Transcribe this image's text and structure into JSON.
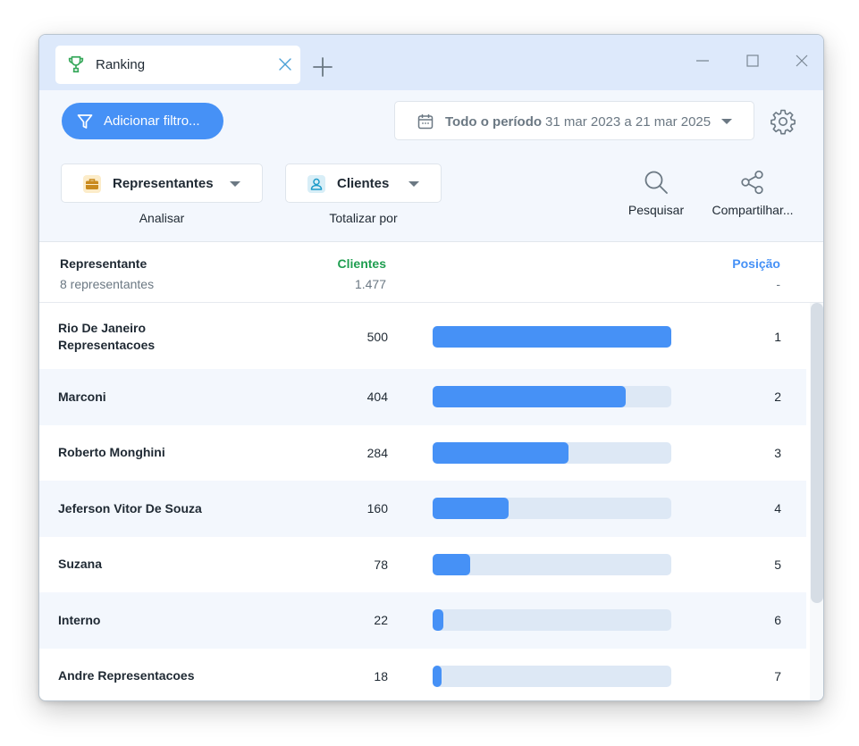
{
  "tab": {
    "title": "Ranking"
  },
  "toolbar": {
    "add_filter_label": "Adicionar filtro...",
    "period_label": "Todo o período",
    "period_range": "31 mar 2023 a 21 mar 2025",
    "analyze": {
      "value": "Representantes",
      "caption": "Analisar"
    },
    "total_by": {
      "value": "Clientes",
      "caption": "Totalizar por"
    },
    "search_label": "Pesquisar",
    "share_label": "Compartilhar..."
  },
  "table": {
    "headers": {
      "representative": "Representante",
      "representative_sub": "8 representantes",
      "clients": "Clientes",
      "clients_sub": "1.477",
      "position": "Posição",
      "position_sub": "-"
    },
    "max_value": 500,
    "rows": [
      {
        "name": "Rio De Janeiro Representacoes",
        "value": 500,
        "position": "1"
      },
      {
        "name": "Marconi",
        "value": 404,
        "position": "2"
      },
      {
        "name": "Roberto Monghini",
        "value": 284,
        "position": "3"
      },
      {
        "name": "Jeferson Vitor De Souza",
        "value": 160,
        "position": "4"
      },
      {
        "name": "Suzana",
        "value": 78,
        "position": "5"
      },
      {
        "name": "Interno",
        "value": 22,
        "position": "6"
      },
      {
        "name": "Andre Representacoes",
        "value": 18,
        "position": "7"
      }
    ]
  },
  "colors": {
    "accent": "#4691f6",
    "clients_header": "#1f9e50",
    "bar_track": "#dde8f5",
    "titlebar": "#dde9fb"
  },
  "icons": {
    "tab": "trophy-icon",
    "filter": "filter-icon",
    "period": "calendar-icon",
    "settings": "gear-icon",
    "analyze": "briefcase-icon",
    "total_by": "user-icon",
    "search": "search-icon",
    "share": "share-icon"
  }
}
